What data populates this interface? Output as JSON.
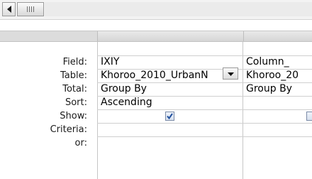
{
  "query_grid": {
    "row_labels": {
      "field": "Field:",
      "table": "Table:",
      "total": "Total:",
      "sort": "Sort:",
      "show": "Show:",
      "criteria": "Criteria:",
      "or": "or:"
    },
    "columns": [
      {
        "field": "IXIY",
        "table": "Khoroo_2010_UrbanN",
        "total": "Group By",
        "sort": "Ascending",
        "show": true
      },
      {
        "field": "Column_",
        "table": "Khoroo_20",
        "total": "Group By",
        "sort": "",
        "show": true
      }
    ]
  },
  "icons": {
    "scroll_left": "left-arrow-icon",
    "scroll_thumb": "grip-icon",
    "dropdown": "chevron-down-icon",
    "checkbox": "checkmark-icon"
  },
  "colors": {
    "header_gray": "#dcdcdc",
    "grid_line": "#c6c6c6",
    "check_blue": "#1f4f9e"
  }
}
